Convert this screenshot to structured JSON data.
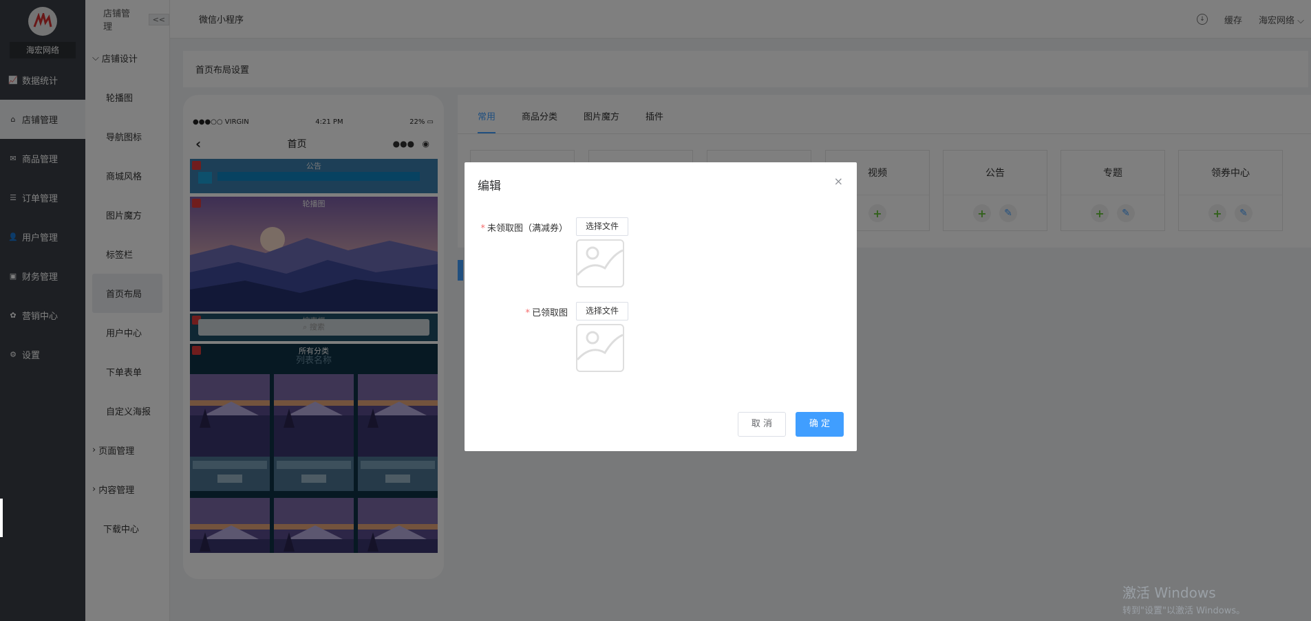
{
  "brand": {
    "name": "海宏网络"
  },
  "left_nav": [
    {
      "label": "数据统计",
      "icon": "chart-icon",
      "active": false
    },
    {
      "label": "店铺管理",
      "icon": "store-icon",
      "active": true
    },
    {
      "label": "商品管理",
      "icon": "mail-icon",
      "active": false
    },
    {
      "label": "订单管理",
      "icon": "list-icon",
      "active": false
    },
    {
      "label": "用户管理",
      "icon": "user-icon",
      "active": false
    },
    {
      "label": "财务管理",
      "icon": "wallet-icon",
      "active": false
    },
    {
      "label": "营销中心",
      "icon": "marketing-icon",
      "active": false
    },
    {
      "label": "设置",
      "icon": "gear-icon",
      "active": false
    }
  ],
  "subnav": {
    "header": "店铺管理",
    "collapse_label": "<<",
    "group_store_design": "店铺设计",
    "items": [
      "轮播图",
      "导航图标",
      "商城风格",
      "图片魔方",
      "标签栏",
      "首页布局",
      "用户中心",
      "下单表单",
      "自定义海报"
    ],
    "group_pages": "页面管理",
    "group_content": "内容管理",
    "download": "下载中心"
  },
  "topbar": {
    "tab": "微信小程序",
    "cache": "缓存",
    "user": "海宏网络"
  },
  "page_header": "首页布局设置",
  "phone": {
    "carrier": "●●●○○ VIRGIN",
    "time": "4:21 PM",
    "battery": "22%",
    "title": "首页",
    "blocks": [
      "公告",
      "轮播图",
      "搜索框",
      "所有分类"
    ],
    "search_placeholder": "搜索",
    "list_title": "列表名称"
  },
  "tabs": [
    "常用",
    "商品分类",
    "图片魔方",
    "插件"
  ],
  "widgets": [
    {
      "title": "视频",
      "edit": false
    },
    {
      "title": "公告",
      "edit": true
    },
    {
      "title": "专题",
      "edit": true
    },
    {
      "title": "领券中心",
      "edit": true
    }
  ],
  "dialog": {
    "title": "编辑",
    "close": "×",
    "fields": [
      {
        "label": "未领取图（满减券）",
        "button": "选择文件"
      },
      {
        "label": "已领取图",
        "button": "选择文件"
      }
    ],
    "cancel": "取 消",
    "confirm": "确 定"
  },
  "watermark": {
    "title": "激活 Windows",
    "subtitle": "转到\"设置\"以激活 Windows。"
  },
  "colors": {
    "primary": "#409eff",
    "nav_bg": "#3a3f46",
    "danger": "#e03b3b",
    "add_green": "#67c23a"
  }
}
